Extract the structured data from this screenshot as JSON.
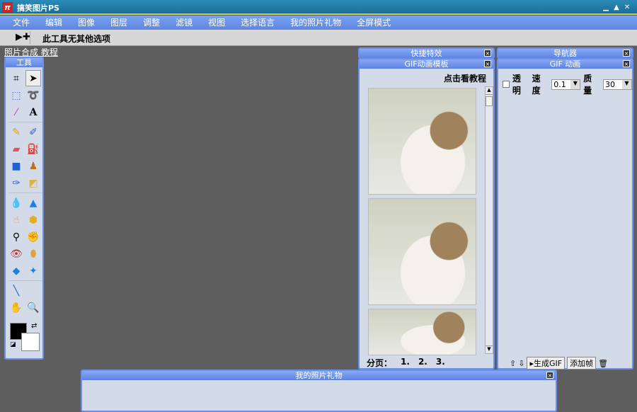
{
  "app": {
    "title": "搞笑图片PS",
    "logo": "π"
  },
  "menu": [
    "文件",
    "编辑",
    "图像",
    "图层",
    "调整",
    "滤镜",
    "视图",
    "选择语言",
    "我的照片礼物",
    "全屏模式"
  ],
  "options": {
    "text": "此工具无其他选项"
  },
  "tutorial_link": "照片合成 教程",
  "toolbox": {
    "title": "工具"
  },
  "panels": {
    "quick_effects": "快捷特效",
    "navigator": "导航器",
    "gif_templates": "GIF动画模板",
    "gif_anim": "GIF 动画",
    "gifts": "我的照片礼物"
  },
  "templates": {
    "tutorial_link": "点击看教程",
    "page_label": "分页：",
    "pages": [
      "1.",
      "2.",
      "3."
    ]
  },
  "gif": {
    "transparent_label": "透明",
    "speed_label": "速度",
    "speed_value": "0.1",
    "quality_label": "质量",
    "quality_value": "30",
    "generate_label": "生成GIF",
    "add_frame_label": "添加帧"
  }
}
